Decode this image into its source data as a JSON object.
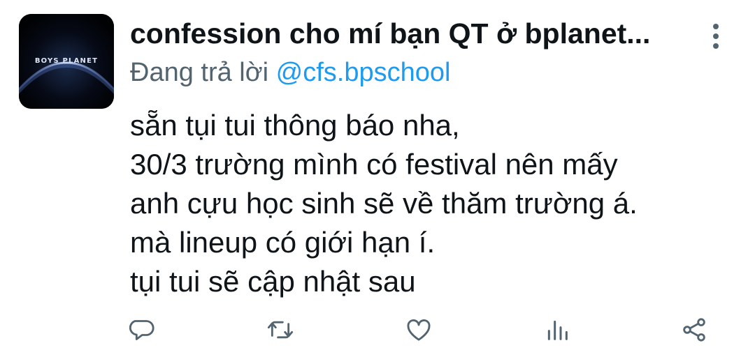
{
  "tweet": {
    "author_name": "confession cho mí bạn QT ở bplanet...",
    "avatar_text": "BOYS PLANET",
    "reply_prefix": "Đang trả lời",
    "reply_handle": "@cfs.bpschool",
    "lines": [
      "sẵn tụi tui thông báo nha,",
      "30/3 trường mình có festival nên mấy",
      "anh cựu học sinh sẽ về thăm trường á.",
      "mà lineup có giới hạn í.",
      "tụi tui sẽ cập nhật sau"
    ]
  },
  "actions": [
    {
      "name": "reply",
      "icon": "comment-icon"
    },
    {
      "name": "retweet",
      "icon": "retweet-icon"
    },
    {
      "name": "like",
      "icon": "heart-icon"
    },
    {
      "name": "analytics",
      "icon": "bar-chart-icon"
    },
    {
      "name": "share",
      "icon": "share-icon"
    }
  ],
  "colors": {
    "text": "#0f1419",
    "secondary": "#536471",
    "link": "#1d9bf0"
  }
}
